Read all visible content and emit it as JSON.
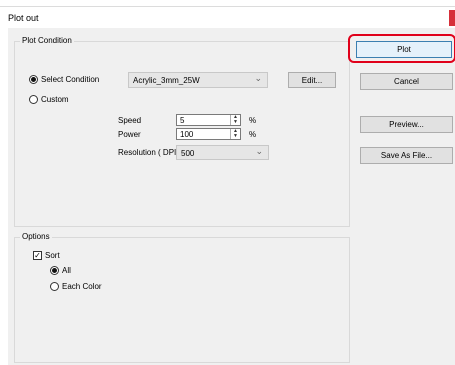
{
  "window": {
    "title": "Plot out"
  },
  "plot_condition": {
    "legend": "Plot Condition",
    "select_condition_label": "Select Condition",
    "custom_label": "Custom",
    "selected_mode": "Select Condition",
    "preset_value": "Acrylic_3mm_25W",
    "edit_label": "Edit...",
    "speed_label": "Speed",
    "speed_value": "5",
    "speed_unit": "%",
    "power_label": "Power",
    "power_value": "100",
    "power_unit": "%",
    "resolution_label": "Resolution ( DPI )",
    "resolution_value": "500"
  },
  "options": {
    "legend": "Options",
    "sort_label": "Sort",
    "sort_checked": true,
    "all_label": "All",
    "each_color_label": "Each Color",
    "selected_sort": "All"
  },
  "buttons": {
    "plot": "Plot",
    "cancel": "Cancel",
    "preview": "Preview...",
    "save_as_file": "Save As File..."
  },
  "colors": {
    "highlight": "#e0001a",
    "close_accent": "#d6303a"
  },
  "icons": [
    "radio-selected",
    "radio-empty",
    "checkbox-checked",
    "chevron-down",
    "spin-up",
    "spin-down"
  ]
}
